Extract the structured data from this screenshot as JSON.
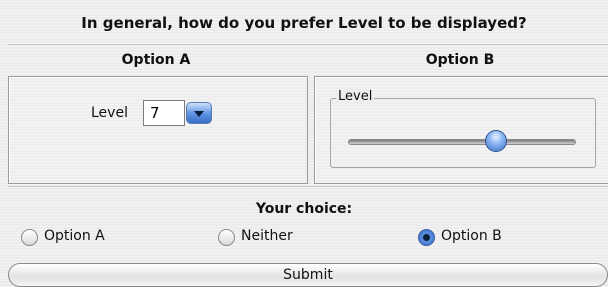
{
  "question": "In general, how do you prefer Level to be displayed?",
  "options": {
    "a_heading": "Option A",
    "b_heading": "Option B"
  },
  "option_a": {
    "level_label": "Level",
    "level_value": "7"
  },
  "option_b": {
    "group_label": "Level",
    "slider_fraction": 0.65
  },
  "choice": {
    "title": "Your choice:",
    "radios": [
      {
        "label": "Option A",
        "selected": false
      },
      {
        "label": "Neither",
        "selected": false
      },
      {
        "label": "Option B",
        "selected": true
      }
    ]
  },
  "submit_label": "Submit",
  "colors": {
    "accent": "#3b72cc",
    "background": "#ececec"
  },
  "icons": {
    "dropdown": "chevron-down-icon",
    "radio": "radio-icon"
  }
}
